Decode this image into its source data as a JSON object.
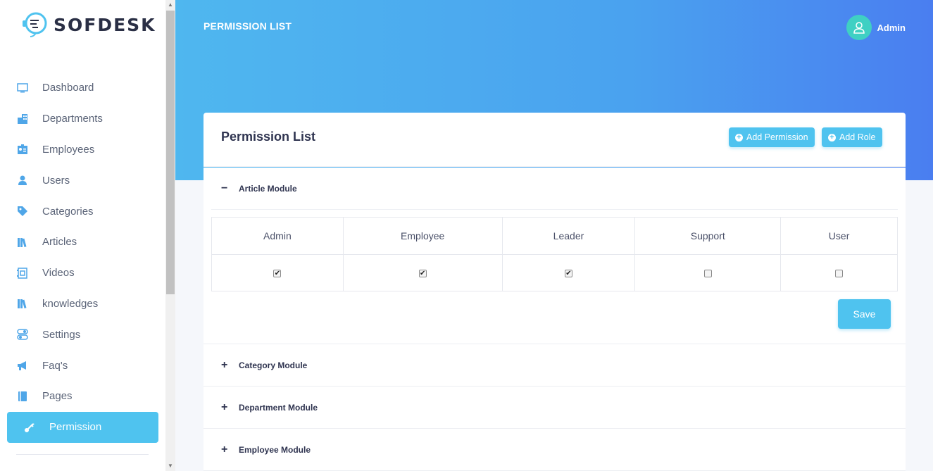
{
  "app": {
    "brand": "SOFDESK"
  },
  "sidebar": {
    "items": [
      {
        "label": "Dashboard",
        "icon": "monitor-icon"
      },
      {
        "label": "Departments",
        "icon": "building-icon"
      },
      {
        "label": "Employees",
        "icon": "id-card-icon"
      },
      {
        "label": "Users",
        "icon": "user-icon"
      },
      {
        "label": "Categories",
        "icon": "tag-icon"
      },
      {
        "label": "Articles",
        "icon": "books-icon"
      },
      {
        "label": "Videos",
        "icon": "video-icon"
      },
      {
        "label": "knowledges",
        "icon": "books-icon"
      },
      {
        "label": "Settings",
        "icon": "toggle-icon"
      },
      {
        "label": "Faq's",
        "icon": "megaphone-icon"
      },
      {
        "label": "Pages",
        "icon": "book-icon"
      },
      {
        "label": "Permission",
        "icon": "key-icon",
        "active": true
      }
    ]
  },
  "header": {
    "title": "PERMISSION LIST",
    "user_name": "Admin"
  },
  "card": {
    "title": "Permission List",
    "add_permission_label": "Add Permission",
    "add_role_label": "Add Role"
  },
  "modules": [
    {
      "name": "Article Module",
      "expanded": true,
      "roles": [
        "Admin",
        "Employee",
        "Leader",
        "Support",
        "User"
      ],
      "checked": [
        true,
        true,
        true,
        false,
        false
      ],
      "save_label": "Save"
    },
    {
      "name": "Category Module",
      "expanded": false
    },
    {
      "name": "Department Module",
      "expanded": false
    },
    {
      "name": "Employee Module",
      "expanded": false
    }
  ],
  "colors": {
    "accent": "#4fc3ef",
    "header_start": "#4fb7ef",
    "header_end": "#4a7ef0",
    "avatar": "#3fd0c3"
  }
}
